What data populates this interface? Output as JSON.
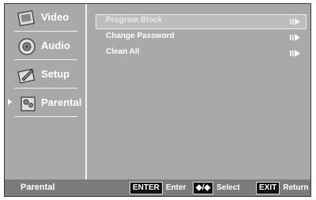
{
  "sidebar": {
    "items": [
      {
        "label": "Video",
        "icon": "video-icon",
        "active": false
      },
      {
        "label": "Audio",
        "icon": "audio-icon",
        "active": false
      },
      {
        "label": "Setup",
        "icon": "setup-icon",
        "active": false
      },
      {
        "label": "Parental",
        "icon": "parental-icon",
        "active": true
      }
    ]
  },
  "menu": {
    "items": [
      {
        "label": "Program Block",
        "selected": true
      },
      {
        "label": "Change Password",
        "selected": false
      },
      {
        "label": "Clean All",
        "selected": false
      }
    ]
  },
  "footer": {
    "title": "Parental",
    "enter_key": "ENTER",
    "enter_label": "Enter",
    "select_key": "◆/◆",
    "select_label": "Select",
    "exit_key": "EXIT",
    "exit_label": "Return"
  },
  "colors": {
    "background": "#a9a9a9",
    "bar": "#7b7b7b",
    "text": "#ffffff"
  }
}
